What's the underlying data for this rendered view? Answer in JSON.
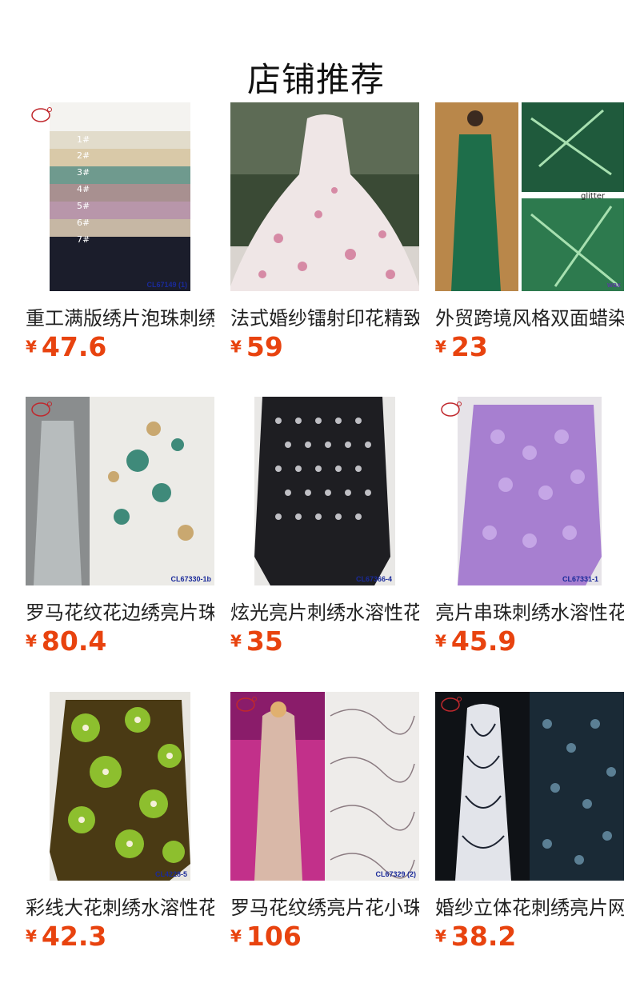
{
  "page": {
    "title": "店铺推荐"
  },
  "currency": "¥",
  "products": [
    {
      "name": "重工满版绣片泡珠刺绣",
      "price": "47.6",
      "code": "CL67149 (1)"
    },
    {
      "name": "法式婚纱镭射印花精致",
      "price": "59",
      "code": ""
    },
    {
      "name": "外贸跨境风格双面蜡染",
      "price": "23",
      "code": "wax"
    },
    {
      "name": "罗马花纹花边绣亮片珠",
      "price": "80.4",
      "code": "CL67330-1b"
    },
    {
      "name": "炫光亮片刺绣水溶性花",
      "price": "35",
      "code": "CL67366-4"
    },
    {
      "name": "亮片串珠刺绣水溶性花",
      "price": "45.9",
      "code": "CL67331-1"
    },
    {
      "name": "彩线大花刺绣水溶性花",
      "price": "42.3",
      "code": "CL4228-5"
    },
    {
      "name": "罗马花纹绣亮片花小珠",
      "price": "106",
      "code": "CL67329 (2)"
    },
    {
      "name": "婚纱立体花刺绣亮片网",
      "price": "38.2",
      "code": ""
    }
  ],
  "image_labels": {
    "swatch_numbers": [
      "1#",
      "2#",
      "3#",
      "4#",
      "5#",
      "6#",
      "7#"
    ],
    "glitter": "glitter"
  }
}
